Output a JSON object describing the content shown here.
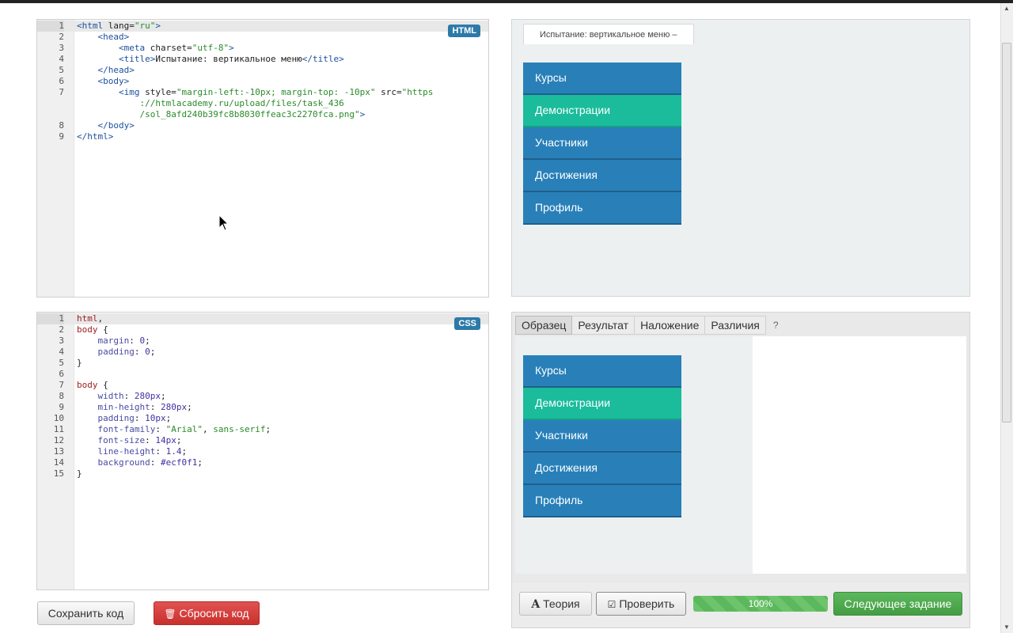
{
  "html_editor": {
    "badge": "HTML",
    "lines": [
      {
        "n": "1",
        "html": "<span class=\"tag\">&lt;html</span> <span class=\"attr\">lang</span>=<span class=\"str\">\"ru\"</span><span class=\"tag\">&gt;</span>"
      },
      {
        "n": "2",
        "html": "    <span class=\"tag\">&lt;head&gt;</span>"
      },
      {
        "n": "3",
        "html": "        <span class=\"tag\">&lt;meta</span> <span class=\"attr\">charset</span>=<span class=\"str\">\"utf-8\"</span><span class=\"tag\">&gt;</span>"
      },
      {
        "n": "4",
        "html": "        <span class=\"tag\">&lt;title&gt;</span>Испытание: вертикальное меню<span class=\"tag\">&lt;/title&gt;</span>"
      },
      {
        "n": "5",
        "html": "    <span class=\"tag\">&lt;/head&gt;</span>"
      },
      {
        "n": "6",
        "html": "    <span class=\"tag\">&lt;body&gt;</span>"
      },
      {
        "n": "7",
        "html": "        <span class=\"tag\">&lt;img</span> <span class=\"attr\">style</span>=<span class=\"str\">\"margin-left:-10px; margin-top: -10px\"</span> <span class=\"attr\">src</span>=<span class=\"str\">\"https</span>"
      },
      {
        "n": "",
        "html": "            <span class=\"str\">://htmlacademy.ru/upload/files/task_436</span>"
      },
      {
        "n": "",
        "html": "            <span class=\"str\">/sol_8afd240b39fc8b8030ffeac3c2270fca.png\"</span><span class=\"tag\">&gt;</span>"
      },
      {
        "n": "8",
        "html": "    <span class=\"tag\">&lt;/body&gt;</span>"
      },
      {
        "n": "9",
        "html": "<span class=\"tag\">&lt;/html&gt;</span>"
      }
    ]
  },
  "css_editor": {
    "badge": "CSS",
    "lines": [
      {
        "n": "1",
        "html": "<span class=\"sel\">html</span>,"
      },
      {
        "n": "2",
        "html": "<span class=\"sel\">body</span> {"
      },
      {
        "n": "3",
        "html": "    <span class=\"prop\">margin</span>: <span class=\"num-v\">0</span>;"
      },
      {
        "n": "4",
        "html": "    <span class=\"prop\">padding</span>: <span class=\"num-v\">0</span>;"
      },
      {
        "n": "5",
        "html": "}"
      },
      {
        "n": "6",
        "html": ""
      },
      {
        "n": "7",
        "html": "<span class=\"sel\">body</span> {"
      },
      {
        "n": "8",
        "html": "    <span class=\"prop\">width</span>: <span class=\"num-v\">280px</span>;"
      },
      {
        "n": "9",
        "html": "    <span class=\"prop\">min-height</span>: <span class=\"num-v\">280px</span>;"
      },
      {
        "n": "10",
        "html": "    <span class=\"prop\">padding</span>: <span class=\"num-v\">10px</span>;"
      },
      {
        "n": "11",
        "html": "    <span class=\"prop\">font-family</span>: <span class=\"str\">\"Arial\"</span>, <span class=\"str\">sans-serif</span>;"
      },
      {
        "n": "12",
        "html": "    <span class=\"prop\">font-size</span>: <span class=\"num-v\">14px</span>;"
      },
      {
        "n": "13",
        "html": "    <span class=\"prop\">line-height</span>: <span class=\"num-v\">1.4</span>;"
      },
      {
        "n": "14",
        "html": "    <span class=\"prop\">background</span>: <span class=\"num-v\">#ecf0f1</span>;"
      },
      {
        "n": "15",
        "html": "}"
      }
    ]
  },
  "preview": {
    "tab_title": "Испытание: вертикальное меню –"
  },
  "menu": {
    "items": [
      {
        "label": "Курсы",
        "active": false
      },
      {
        "label": "Демонстрации",
        "active": true
      },
      {
        "label": "Участники",
        "active": false
      },
      {
        "label": "Достижения",
        "active": false
      },
      {
        "label": "Профиль",
        "active": false
      }
    ]
  },
  "compare": {
    "tabs": [
      {
        "label": "Образец",
        "active": true
      },
      {
        "label": "Результат",
        "active": false
      },
      {
        "label": "Наложение",
        "active": false
      },
      {
        "label": "Различия",
        "active": false
      }
    ],
    "help": "?"
  },
  "footer": {
    "save": "Сохранить код",
    "reset": "Сбросить код",
    "theory": "Теория",
    "check": "Проверить",
    "progress_label": "100%",
    "progress_value": 100,
    "next": "Следующее задание"
  },
  "icons": {
    "theory": "book-a-icon",
    "check": "check-square-icon",
    "reset": "trash-icon"
  },
  "colors": {
    "menu_blue": "#2980b9",
    "menu_active": "#1abc9c",
    "preview_bg": "#ecf0f1",
    "badge": "#2d7aa8",
    "success": "#5cb85c",
    "danger": "#d9534f"
  }
}
